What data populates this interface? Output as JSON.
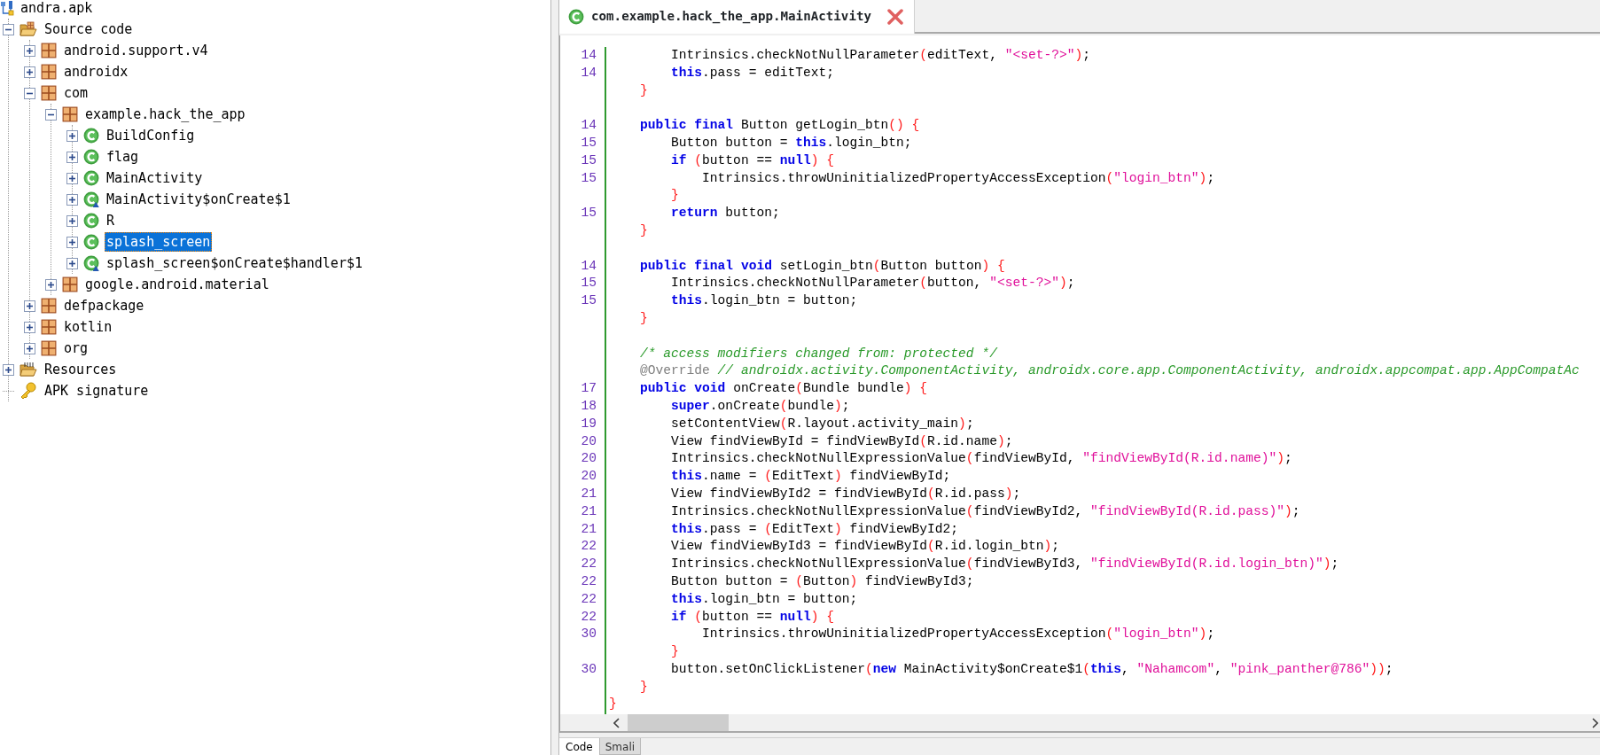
{
  "tree": {
    "label": "andra.apk",
    "kind": "apk",
    "selected": false,
    "children": [
      {
        "label": "Source code",
        "kind": "source-folder",
        "expanded": true,
        "selected": false,
        "children": [
          {
            "label": "android.support.v4",
            "kind": "package",
            "expanded": false,
            "selected": false
          },
          {
            "label": "androidx",
            "kind": "package",
            "expanded": false,
            "selected": false
          },
          {
            "label": "com",
            "kind": "package",
            "expanded": true,
            "selected": false,
            "children": [
              {
                "label": "example.hack_the_app",
                "kind": "package",
                "expanded": true,
                "selected": false,
                "children": [
                  {
                    "label": "BuildConfig",
                    "kind": "class",
                    "expanded": false,
                    "selected": false
                  },
                  {
                    "label": "flag",
                    "kind": "class",
                    "expanded": false,
                    "selected": false
                  },
                  {
                    "label": "MainActivity",
                    "kind": "class",
                    "expanded": false,
                    "selected": false
                  },
                  {
                    "label": "MainActivity$onCreate$1",
                    "kind": "inner-class",
                    "expanded": false,
                    "selected": false
                  },
                  {
                    "label": "R",
                    "kind": "class",
                    "expanded": false,
                    "selected": false
                  },
                  {
                    "label": "splash_screen",
                    "kind": "class",
                    "expanded": false,
                    "selected": true
                  },
                  {
                    "label": "splash_screen$onCreate$handler$1",
                    "kind": "inner-class",
                    "expanded": false,
                    "selected": false
                  }
                ]
              },
              {
                "label": "google.android.material",
                "kind": "package",
                "expanded": false,
                "selected": false
              }
            ]
          },
          {
            "label": "defpackage",
            "kind": "package",
            "expanded": false,
            "selected": false
          },
          {
            "label": "kotlin",
            "kind": "package",
            "expanded": false,
            "selected": false
          },
          {
            "label": "org",
            "kind": "package",
            "expanded": false,
            "selected": false
          }
        ]
      },
      {
        "label": "Resources",
        "kind": "resources-folder",
        "expanded": false,
        "selected": false
      },
      {
        "label": "APK signature",
        "kind": "key",
        "selected": false
      }
    ]
  },
  "editor_tab": {
    "title": "com.example.hack_the_app.MainActivity",
    "selected": true
  },
  "code_lines": [
    {
      "number": "14",
      "tokens": [
        {
          "kind": "plain",
          "text": "        Intrinsics.checkNotNullParameter"
        },
        {
          "kind": "bracket",
          "text": "("
        },
        {
          "kind": "plain",
          "text": "editText, "
        },
        {
          "kind": "string",
          "text": "\"<set-?>\""
        },
        {
          "kind": "bracket",
          "text": ")"
        },
        {
          "kind": "plain",
          "text": ";"
        }
      ]
    },
    {
      "number": "14",
      "tokens": [
        {
          "kind": "keyword",
          "text": "        this"
        },
        {
          "kind": "plain",
          "text": ".pass = editText;"
        }
      ]
    },
    {
      "tokens": [
        {
          "kind": "bracket",
          "text": "    }"
        }
      ]
    },
    {
      "number": "14",
      "blank_before": true,
      "tokens": [
        {
          "kind": "keyword",
          "text": "    public final"
        },
        {
          "kind": "plain",
          "text": " Button getLogin_btn"
        },
        {
          "kind": "bracket",
          "text": "() {"
        }
      ]
    },
    {
      "number": "15",
      "tokens": [
        {
          "kind": "plain",
          "text": "        Button button = "
        },
        {
          "kind": "keyword",
          "text": "this"
        },
        {
          "kind": "plain",
          "text": ".login_btn;"
        }
      ]
    },
    {
      "number": "15",
      "tokens": [
        {
          "kind": "keyword",
          "text": "        if"
        },
        {
          "kind": "bracket",
          "text": " ("
        },
        {
          "kind": "plain",
          "text": "button == "
        },
        {
          "kind": "keyword",
          "text": "null"
        },
        {
          "kind": "bracket",
          "text": ") {"
        }
      ]
    },
    {
      "number": "15",
      "tokens": [
        {
          "kind": "plain",
          "text": "            Intrinsics.throwUninitializedPropertyAccessException"
        },
        {
          "kind": "bracket",
          "text": "("
        },
        {
          "kind": "string",
          "text": "\"login_btn\""
        },
        {
          "kind": "bracket",
          "text": ")"
        },
        {
          "kind": "plain",
          "text": ";"
        }
      ]
    },
    {
      "tokens": [
        {
          "kind": "bracket",
          "text": "        }"
        }
      ]
    },
    {
      "number": "15",
      "tokens": [
        {
          "kind": "keyword",
          "text": "        return"
        },
        {
          "kind": "plain",
          "text": " button;"
        }
      ]
    },
    {
      "tokens": [
        {
          "kind": "bracket",
          "text": "    }"
        }
      ]
    },
    {
      "number": "14",
      "blank_before": true,
      "tokens": [
        {
          "kind": "keyword",
          "text": "    public final void"
        },
        {
          "kind": "plain",
          "text": " setLogin_btn"
        },
        {
          "kind": "bracket",
          "text": "("
        },
        {
          "kind": "plain",
          "text": "Button button"
        },
        {
          "kind": "bracket",
          "text": ") {"
        }
      ]
    },
    {
      "number": "15",
      "tokens": [
        {
          "kind": "plain",
          "text": "        Intrinsics.checkNotNullParameter"
        },
        {
          "kind": "bracket",
          "text": "("
        },
        {
          "kind": "plain",
          "text": "button, "
        },
        {
          "kind": "string",
          "text": "\"<set-?>\""
        },
        {
          "kind": "bracket",
          "text": ")"
        },
        {
          "kind": "plain",
          "text": ";"
        }
      ]
    },
    {
      "number": "15",
      "tokens": [
        {
          "kind": "keyword",
          "text": "        this"
        },
        {
          "kind": "plain",
          "text": ".login_btn = button;"
        }
      ]
    },
    {
      "tokens": [
        {
          "kind": "bracket",
          "text": "    }"
        }
      ]
    },
    {
      "blank_before": true,
      "tokens": [
        {
          "kind": "comment",
          "text": "    /* access modifiers changed from: protected */"
        }
      ]
    },
    {
      "tokens": [
        {
          "kind": "annotation",
          "text": "    @Override"
        },
        {
          "kind": "comment",
          "text": " // androidx.activity.ComponentActivity, androidx.core.app.ComponentActivity, androidx.appcompat.app.AppCompatAc"
        }
      ]
    },
    {
      "number": "17",
      "tokens": [
        {
          "kind": "keyword",
          "text": "    public void"
        },
        {
          "kind": "plain",
          "text": " onCreate"
        },
        {
          "kind": "bracket",
          "text": "("
        },
        {
          "kind": "plain",
          "text": "Bundle bundle"
        },
        {
          "kind": "bracket",
          "text": ") {"
        }
      ]
    },
    {
      "number": "18",
      "tokens": [
        {
          "kind": "keyword",
          "text": "        super"
        },
        {
          "kind": "plain",
          "text": ".onCreate"
        },
        {
          "kind": "bracket",
          "text": "("
        },
        {
          "kind": "plain",
          "text": "bundle"
        },
        {
          "kind": "bracket",
          "text": ")"
        },
        {
          "kind": "plain",
          "text": ";"
        }
      ]
    },
    {
      "number": "19",
      "tokens": [
        {
          "kind": "plain",
          "text": "        setContentView"
        },
        {
          "kind": "bracket",
          "text": "("
        },
        {
          "kind": "plain",
          "text": "R.layout.activity_main"
        },
        {
          "kind": "bracket",
          "text": ")"
        },
        {
          "kind": "plain",
          "text": ";"
        }
      ]
    },
    {
      "number": "20",
      "tokens": [
        {
          "kind": "plain",
          "text": "        View findViewById = findViewById"
        },
        {
          "kind": "bracket",
          "text": "("
        },
        {
          "kind": "plain",
          "text": "R.id.name"
        },
        {
          "kind": "bracket",
          "text": ")"
        },
        {
          "kind": "plain",
          "text": ";"
        }
      ]
    },
    {
      "number": "20",
      "tokens": [
        {
          "kind": "plain",
          "text": "        Intrinsics.checkNotNullExpressionValue"
        },
        {
          "kind": "bracket",
          "text": "("
        },
        {
          "kind": "plain",
          "text": "findViewById, "
        },
        {
          "kind": "string",
          "text": "\"findViewById(R.id.name)\""
        },
        {
          "kind": "bracket",
          "text": ")"
        },
        {
          "kind": "plain",
          "text": ";"
        }
      ]
    },
    {
      "number": "20",
      "tokens": [
        {
          "kind": "keyword",
          "text": "        this"
        },
        {
          "kind": "plain",
          "text": ".name = "
        },
        {
          "kind": "bracket",
          "text": "("
        },
        {
          "kind": "plain",
          "text": "EditText"
        },
        {
          "kind": "bracket",
          "text": ")"
        },
        {
          "kind": "plain",
          "text": " findViewById;"
        }
      ]
    },
    {
      "number": "21",
      "tokens": [
        {
          "kind": "plain",
          "text": "        View findViewById2 = findViewById"
        },
        {
          "kind": "bracket",
          "text": "("
        },
        {
          "kind": "plain",
          "text": "R.id.pass"
        },
        {
          "kind": "bracket",
          "text": ")"
        },
        {
          "kind": "plain",
          "text": ";"
        }
      ]
    },
    {
      "number": "21",
      "tokens": [
        {
          "kind": "plain",
          "text": "        Intrinsics.checkNotNullExpressionValue"
        },
        {
          "kind": "bracket",
          "text": "("
        },
        {
          "kind": "plain",
          "text": "findViewById2, "
        },
        {
          "kind": "string",
          "text": "\"findViewById(R.id.pass)\""
        },
        {
          "kind": "bracket",
          "text": ")"
        },
        {
          "kind": "plain",
          "text": ";"
        }
      ]
    },
    {
      "number": "21",
      "tokens": [
        {
          "kind": "keyword",
          "text": "        this"
        },
        {
          "kind": "plain",
          "text": ".pass = "
        },
        {
          "kind": "bracket",
          "text": "("
        },
        {
          "kind": "plain",
          "text": "EditText"
        },
        {
          "kind": "bracket",
          "text": ")"
        },
        {
          "kind": "plain",
          "text": " findViewById2;"
        }
      ]
    },
    {
      "number": "22",
      "tokens": [
        {
          "kind": "plain",
          "text": "        View findViewById3 = findViewById"
        },
        {
          "kind": "bracket",
          "text": "("
        },
        {
          "kind": "plain",
          "text": "R.id.login_btn"
        },
        {
          "kind": "bracket",
          "text": ")"
        },
        {
          "kind": "plain",
          "text": ";"
        }
      ]
    },
    {
      "number": "22",
      "tokens": [
        {
          "kind": "plain",
          "text": "        Intrinsics.checkNotNullExpressionValue"
        },
        {
          "kind": "bracket",
          "text": "("
        },
        {
          "kind": "plain",
          "text": "findViewById3, "
        },
        {
          "kind": "string",
          "text": "\"findViewById(R.id.login_btn)\""
        },
        {
          "kind": "bracket",
          "text": ")"
        },
        {
          "kind": "plain",
          "text": ";"
        }
      ]
    },
    {
      "number": "22",
      "tokens": [
        {
          "kind": "plain",
          "text": "        Button button = "
        },
        {
          "kind": "bracket",
          "text": "("
        },
        {
          "kind": "plain",
          "text": "Button"
        },
        {
          "kind": "bracket",
          "text": ")"
        },
        {
          "kind": "plain",
          "text": " findViewById3;"
        }
      ]
    },
    {
      "number": "22",
      "tokens": [
        {
          "kind": "keyword",
          "text": "        this"
        },
        {
          "kind": "plain",
          "text": ".login_btn = button;"
        }
      ]
    },
    {
      "number": "22",
      "tokens": [
        {
          "kind": "keyword",
          "text": "        if"
        },
        {
          "kind": "bracket",
          "text": " ("
        },
        {
          "kind": "plain",
          "text": "button == "
        },
        {
          "kind": "keyword",
          "text": "null"
        },
        {
          "kind": "bracket",
          "text": ") {"
        }
      ]
    },
    {
      "number": "30",
      "tokens": [
        {
          "kind": "plain",
          "text": "            Intrinsics.throwUninitializedPropertyAccessException"
        },
        {
          "kind": "bracket",
          "text": "("
        },
        {
          "kind": "string",
          "text": "\"login_btn\""
        },
        {
          "kind": "bracket",
          "text": ")"
        },
        {
          "kind": "plain",
          "text": ";"
        }
      ]
    },
    {
      "tokens": [
        {
          "kind": "bracket",
          "text": "        }"
        }
      ]
    },
    {
      "number": "30",
      "tokens": [
        {
          "kind": "plain",
          "text": "        button.setOnClickListener"
        },
        {
          "kind": "bracket",
          "text": "("
        },
        {
          "kind": "keyword",
          "text": "new"
        },
        {
          "kind": "plain",
          "text": " MainActivity$onCreate$1"
        },
        {
          "kind": "bracket",
          "text": "("
        },
        {
          "kind": "keyword",
          "text": "this"
        },
        {
          "kind": "plain",
          "text": ", "
        },
        {
          "kind": "string",
          "text": "\"Nahamcom\""
        },
        {
          "kind": "plain",
          "text": ", "
        },
        {
          "kind": "string",
          "text": "\"pink_panther@786\""
        },
        {
          "kind": "bracket",
          "text": "))"
        },
        {
          "kind": "plain",
          "text": ";"
        }
      ]
    },
    {
      "tokens": [
        {
          "kind": "bracket",
          "text": "    }"
        }
      ]
    },
    {
      "tokens": [
        {
          "kind": "bracket",
          "text": "}"
        }
      ]
    }
  ],
  "bottom_tabs": [
    {
      "label": "Code",
      "selected": true
    },
    {
      "label": "Smali",
      "selected": false
    }
  ]
}
